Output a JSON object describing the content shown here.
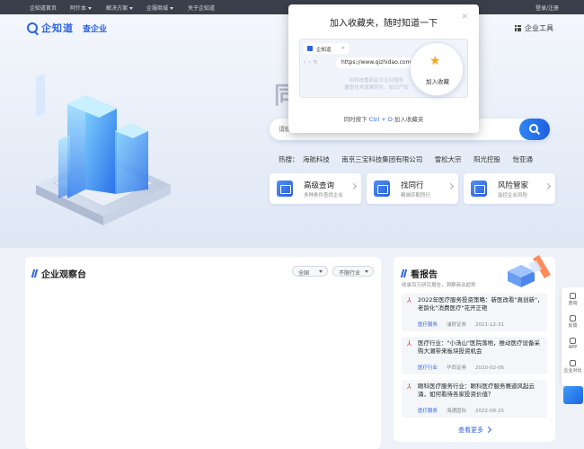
{
  "topbar": {
    "items": [
      "企知道首页",
      "阿什本",
      "解决方案",
      "企服商城",
      "关于企知道"
    ],
    "login": "登录/注册"
  },
  "header": {
    "brand": "企知道",
    "product": "查企业",
    "tools": "企业工具"
  },
  "hero": {
    "title_partial": "同",
    "search_placeholder": "请输",
    "hot_label": "热搜：",
    "hot_items": [
      "海航科技",
      "南京三宝科技集团有限公司",
      "雪松大宗",
      "阳光控股",
      "怡亚通"
    ]
  },
  "features": [
    {
      "title": "高级查询",
      "desc": "多种条件查找企业"
    },
    {
      "title": "找同行",
      "desc": "精准匹配同行"
    },
    {
      "title": "风险管家",
      "desc": "监控企业风险"
    }
  ],
  "observatory": {
    "title": "企业观察台",
    "region": "全国",
    "industry": "不限行业"
  },
  "reports": {
    "title": "看报告",
    "subtitle": "收录百万研究报告，洞察商业趋势",
    "items": [
      {
        "title": "2022年医疗服务投资策略：新医改看\"真创新\"，老龄化\"消费医疗\"花开正艳",
        "category": "医疗服务",
        "source": "浦财证券",
        "date": "2021-12-31"
      },
      {
        "title": "医疗行业：\"小汤山\"医院落地，推动医疗设备采购大潮带来板块投资机会",
        "category": "医疗行业",
        "source": "华西证券",
        "date": "2020-02-06"
      },
      {
        "title": "眼科医疗服务行业：眼科医疗服务赛道风起云涌，如何看待各家投资价值？",
        "category": "医疗服务",
        "source": "海通国际",
        "date": "2022-08-25"
      }
    ],
    "more": "查看更多"
  },
  "sidebar": {
    "items": [
      "咨询",
      "反馈",
      "APP",
      "企业对比"
    ]
  },
  "modal": {
    "title": "加入收藏夹，随时知道一下",
    "tab_label": "企知道",
    "url": "https://www.qizhidao.com",
    "ghost_line1": "用科技重新定义企业服务",
    "ghost_line2": "覆盖技术成果转化、知识产权",
    "bookmark_label": "加入收藏",
    "hint_prefix": "同时按下",
    "hint_keys": "Ctrl + D",
    "hint_suffix": "加入收藏夹"
  },
  "colors": {
    "accent": "#2c63e0",
    "topbar": "#3a3f4b"
  }
}
